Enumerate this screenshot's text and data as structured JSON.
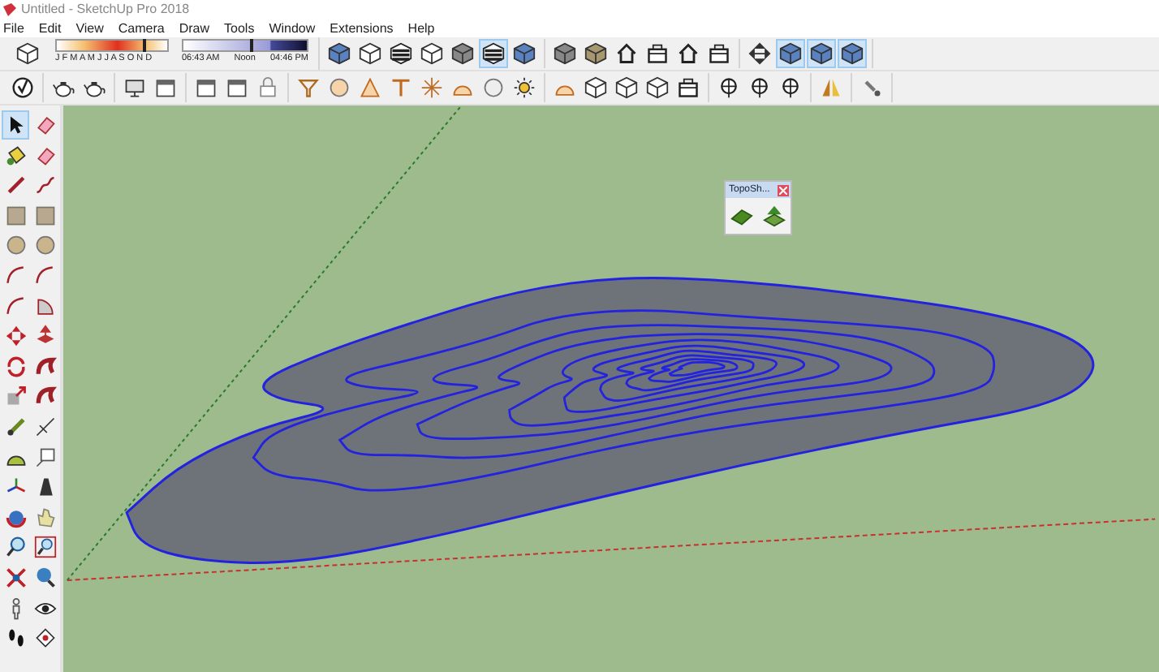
{
  "window": {
    "title": "Untitled - SketchUp Pro 2018"
  },
  "menu": [
    "File",
    "Edit",
    "View",
    "Camera",
    "Draw",
    "Tools",
    "Window",
    "Extensions",
    "Help"
  ],
  "shadow_settings": {
    "months": "J F M A M J J A S O N D",
    "month_slider": {
      "level": 0.8
    },
    "times": [
      "06:43 AM",
      "Noon",
      "04:46 PM"
    ],
    "time_slider": {
      "level": 0.55
    }
  },
  "toolbar_row_1": [
    {
      "selected": false
    },
    {
      "selected": false
    },
    {
      "selected": false
    },
    {
      "selected": false
    },
    {
      "selected": false
    },
    {
      "selected": true
    },
    {
      "selected": false
    },
    {
      "selected": false
    },
    {
      "selected": false
    },
    {
      "selected": false
    },
    {
      "selected": false
    },
    {
      "selected": false
    },
    {
      "selected": false
    },
    {
      "selected": false
    },
    {
      "selected": true
    },
    {
      "selected": true
    },
    {
      "selected": true
    }
  ],
  "toolbar_row_2": [
    {
      "selected": false
    },
    {
      "selected": false
    },
    {
      "selected": false
    },
    {
      "selected": false
    },
    {
      "selected": false
    },
    {
      "selected": false
    },
    {
      "selected": false
    },
    {
      "selected": false
    },
    {
      "selected": false
    },
    {
      "selected": false
    },
    {
      "selected": false
    },
    {
      "selected": false
    },
    {
      "selected": false
    },
    {
      "selected": false
    },
    {
      "selected": false
    },
    {
      "selected": false
    },
    {
      "selected": false
    },
    {
      "selected": false
    },
    {
      "selected": false
    },
    {
      "selected": false
    },
    {
      "selected": false
    },
    {
      "selected": false
    },
    {
      "selected": false
    },
    {
      "selected": false
    },
    {
      "selected": false
    },
    {
      "selected": false
    }
  ],
  "tool_palette": [
    {
      "selected": true
    },
    {
      "selected": false
    },
    {
      "selected": false
    },
    {
      "selected": false
    },
    {
      "selected": false
    },
    {
      "selected": false
    },
    {
      "selected": false
    },
    {
      "selected": false
    },
    {
      "selected": false
    },
    {
      "selected": false
    },
    {
      "selected": false
    },
    {
      "selected": false
    },
    {
      "selected": false
    },
    {
      "selected": false
    },
    {
      "selected": false
    },
    {
      "selected": false
    },
    {
      "selected": false
    },
    {
      "selected": false
    },
    {
      "selected": false
    },
    {
      "selected": false
    },
    {
      "selected": false
    },
    {
      "selected": false
    },
    {
      "selected": false
    },
    {
      "selected": false
    },
    {
      "selected": false
    },
    {
      "selected": false
    },
    {
      "selected": false
    },
    {
      "selected": false
    },
    {
      "selected": false
    },
    {
      "selected": false
    },
    {
      "selected": false
    },
    {
      "selected": false
    },
    {
      "selected": false
    },
    {
      "selected": false
    },
    {
      "selected": false
    },
    {
      "selected": false
    }
  ],
  "floating_toolbar": {
    "title": "TopoSh...",
    "buttons": [
      {
        "selected": false
      },
      {
        "selected": false
      }
    ]
  }
}
